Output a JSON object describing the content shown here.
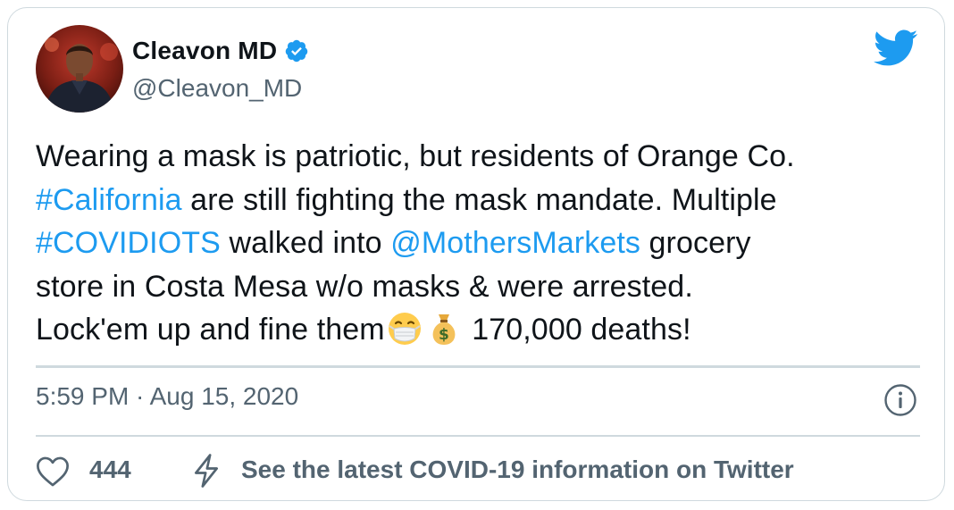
{
  "author": {
    "display_name": "Cleavon MD",
    "handle": "@Cleavon_MD",
    "verified_icon": "verified-badge-icon",
    "avatar_desc": "profile photo"
  },
  "brand": {
    "icon": "twitter-bird-icon",
    "color": "#1d9bf0"
  },
  "tweet": {
    "line1": "Wearing a mask is patriotic, but residents of Orange Co.",
    "l2_link": "#California",
    "l2_text": " are still fighting the mask mandate. Multiple",
    "l3_link1": "#COVIDIOTS",
    "l3_text1": " walked into ",
    "l3_link2": "@MothersMarkets",
    "l3_text2": " grocery",
    "line4": "store in Costa Mesa w/o masks & were arrested.",
    "l5_text1": "Lock'em up and fine them",
    "l5_text2": " 170,000 deaths!",
    "emojis": [
      "face-with-medical-mask-emoji",
      "money-bag-emoji"
    ]
  },
  "meta": {
    "timestamp": "5:59 PM · Aug 15, 2020",
    "info_icon": "info-icon"
  },
  "actions": {
    "like_icon": "heart-icon",
    "like_count": "444",
    "covid_icon": "lightning-bolt-icon",
    "covid_text": "See the latest COVID-19 information on Twitter"
  },
  "colors": {
    "link": "#1d9bf0",
    "text": "#0f1419",
    "secondary": "#536471",
    "border": "#cfd9de"
  }
}
